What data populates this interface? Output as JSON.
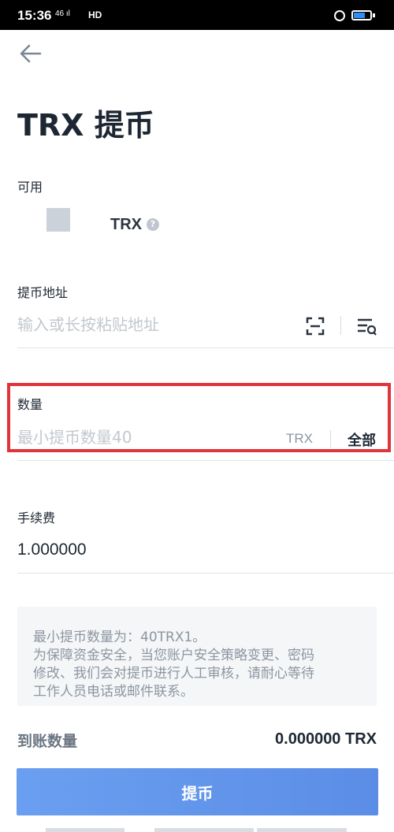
{
  "status_bar": {
    "time": "15:36",
    "signal": "46 ıl",
    "network": "HD",
    "battery_level": 0.55
  },
  "header": {
    "title": "TRX 提币"
  },
  "available": {
    "label": "可用",
    "value": "TRX",
    "help_icon": "?"
  },
  "address": {
    "label": "提币地址",
    "placeholder": "输入或长按粘贴地址",
    "scan_icon": "scan-icon",
    "addressbook_icon": "address-book-icon"
  },
  "amount": {
    "label": "数量",
    "placeholder": "最小提币数量40",
    "unit": "TRX",
    "all_label": "全部"
  },
  "fee": {
    "label": "手续费",
    "value": "1.000000"
  },
  "notice": {
    "lines": [
      "最小提币数量为：40TRX1。",
      "为保障资金安全，当您账户安全策略变更、密码",
      "修改、我们会对提币进行人工审核，请耐心等待",
      "工作人员电话或邮件联系。"
    ]
  },
  "receive": {
    "label": "到账数量",
    "value": "0.000000 TRX"
  },
  "submit": {
    "label": "提币"
  },
  "colors": {
    "accent": "#5b8de6",
    "highlight": "#e0333a",
    "text_primary": "#1d2733",
    "placeholder": "#c2c8cf"
  }
}
